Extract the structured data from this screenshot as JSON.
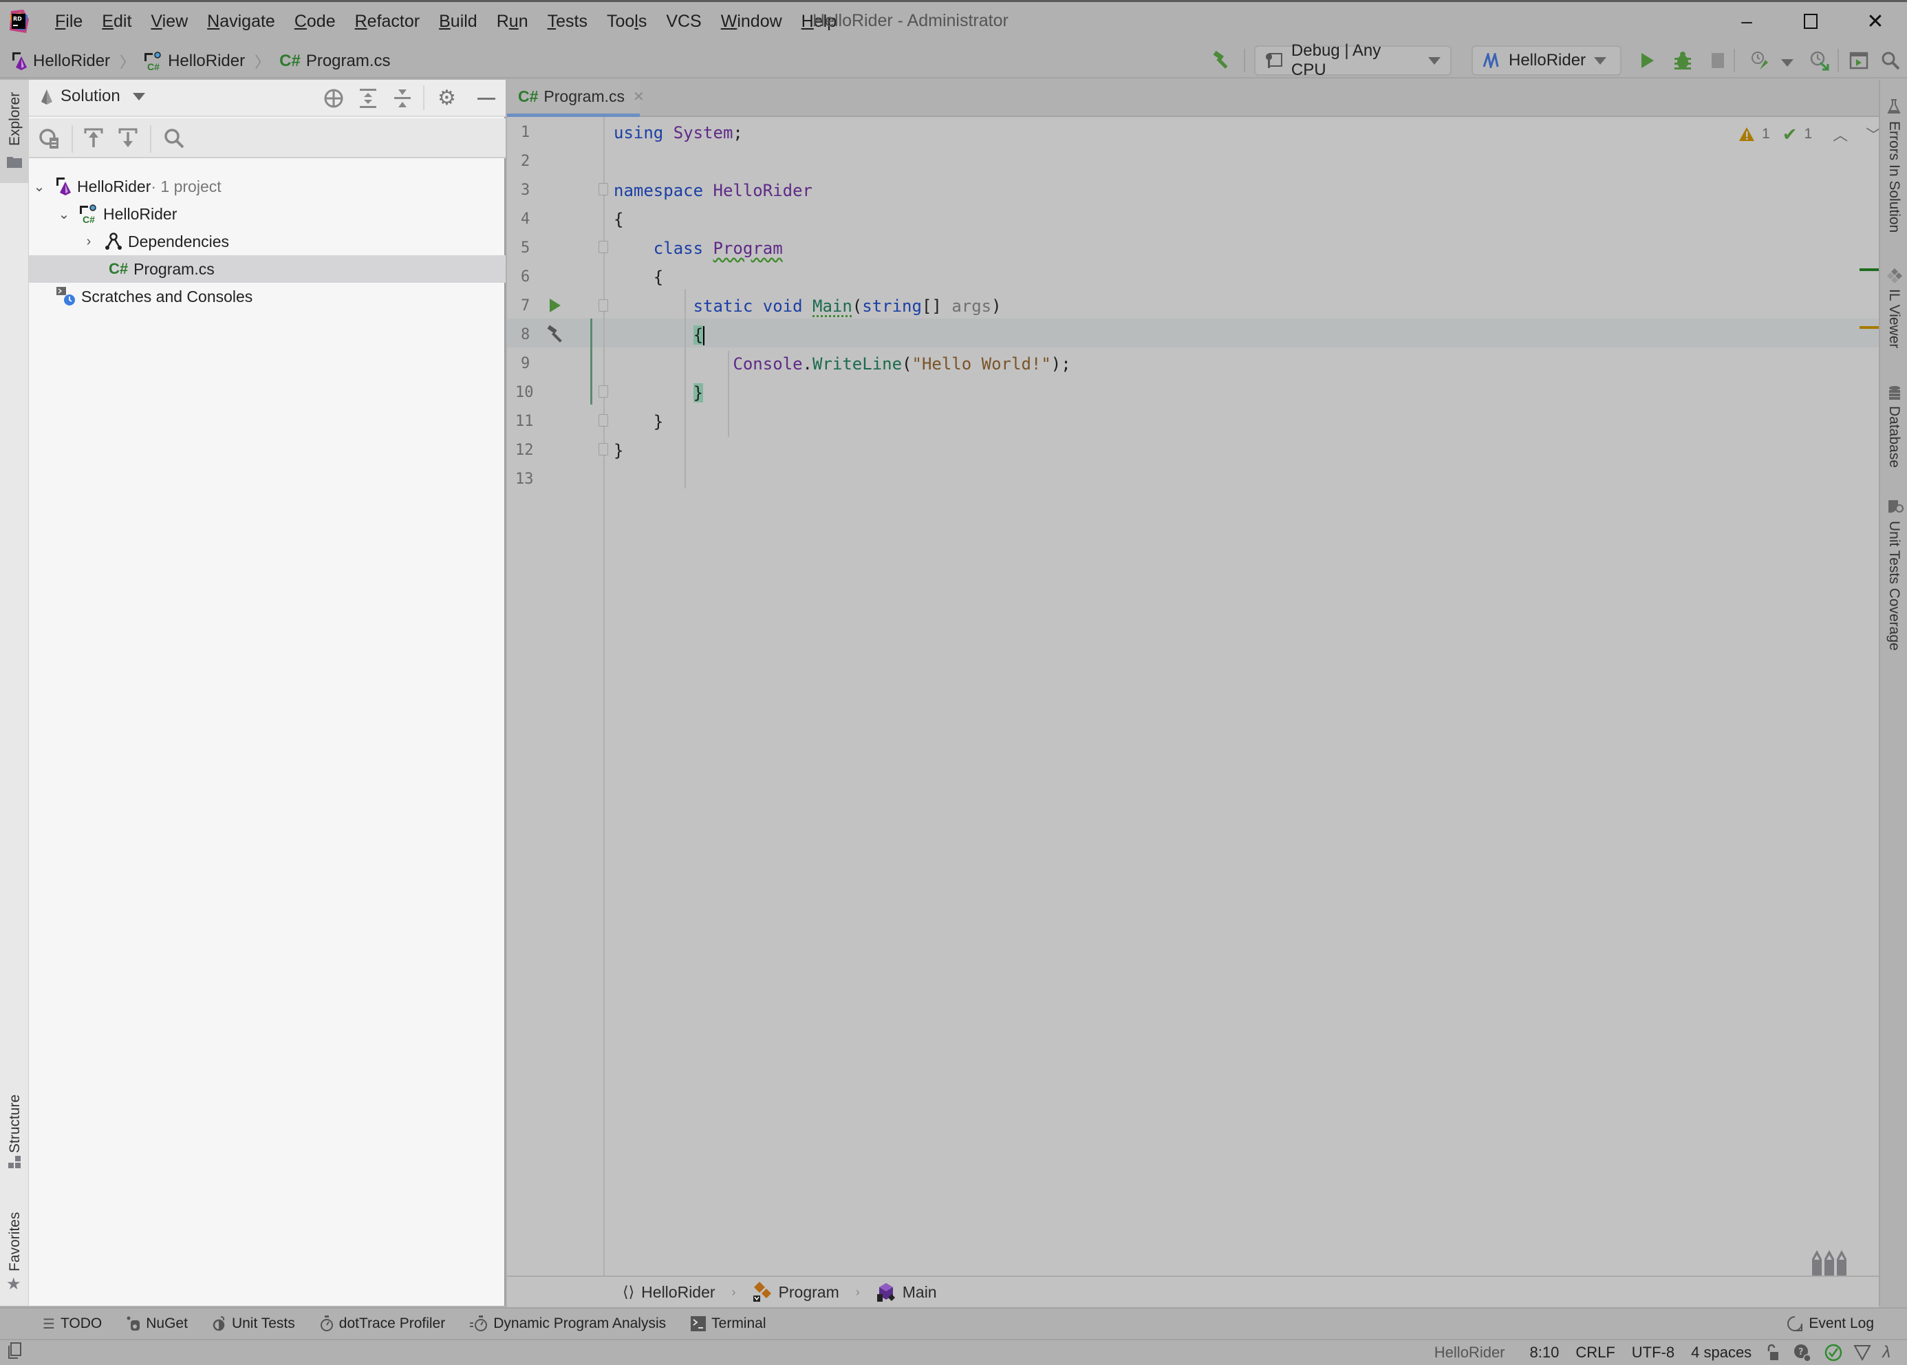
{
  "window": {
    "title": "HelloRider - Administrator",
    "controls": {
      "minimize": "–",
      "maximize": "☐",
      "close": "✕"
    }
  },
  "menu": [
    {
      "label": "File",
      "mnemonic": "F",
      "rest": "ile"
    },
    {
      "label": "Edit",
      "mnemonic": "E",
      "rest": "dit"
    },
    {
      "label": "View",
      "mnemonic": "V",
      "rest": "iew"
    },
    {
      "label": "Navigate",
      "mnemonic": "N",
      "rest": "avigate"
    },
    {
      "label": "Code",
      "mnemonic": "C",
      "rest": "ode"
    },
    {
      "label": "Refactor",
      "mnemonic": "R",
      "rest": "efactor"
    },
    {
      "label": "Build",
      "mnemonic": "B",
      "rest": "uild"
    },
    {
      "label": "Run",
      "pre": "R",
      "mnemonic": "u",
      "rest": "n"
    },
    {
      "label": "Tests",
      "mnemonic": "T",
      "rest": "ests"
    },
    {
      "label": "Tools",
      "pre": "Too",
      "mnemonic": "l",
      "rest": "s"
    },
    {
      "label": "VCS",
      "pre": "VCS",
      "mnemonic": "",
      "rest": ""
    },
    {
      "label": "Window",
      "mnemonic": "W",
      "rest": "indow"
    },
    {
      "label": "Help",
      "mnemonic": "H",
      "rest": "elp"
    }
  ],
  "navbar": {
    "breadcrumbs": [
      {
        "label": "HelloRider",
        "icon": "solution-icon"
      },
      {
        "label": "HelloRider",
        "icon": "csharp-project-icon"
      },
      {
        "label": "Program.cs",
        "icon": "csharp-file-icon"
      }
    ],
    "configuration": "Debug | Any CPU",
    "run_target": "HelloRider"
  },
  "left_stripe": {
    "top_tab": "Explorer",
    "bottom_tabs": [
      "Structure",
      "Favorites"
    ]
  },
  "explorer": {
    "view_selector": "Solution",
    "tree": [
      {
        "label": "HelloRider",
        "suffix": " · 1 project",
        "depth": 0,
        "expanded": true,
        "icon": "solution-icon"
      },
      {
        "label": "HelloRider",
        "depth": 1,
        "expanded": true,
        "icon": "csharp-project-icon"
      },
      {
        "label": "Dependencies",
        "depth": 2,
        "expanded": false,
        "icon": "dependencies-icon"
      },
      {
        "label": "Program.cs",
        "depth": 2,
        "selected": true,
        "icon": "csharp-file-icon"
      },
      {
        "label": "Scratches and Consoles",
        "depth": 0,
        "icon": "scratches-icon"
      }
    ]
  },
  "editor": {
    "tab": {
      "label": "Program.cs",
      "lang": "C#"
    },
    "inspection": {
      "warnings": "1",
      "ok": "1"
    },
    "lines": [
      "using System;",
      "",
      "namespace HelloRider",
      "{",
      "    class Program",
      "    {",
      "        static void Main(string[] args)",
      "        {",
      "            Console.WriteLine(\"Hello World!\");",
      "        }",
      "    }",
      "}",
      ""
    ],
    "line_numbers": [
      "1",
      "2",
      "3",
      "4",
      "5",
      "6",
      "7",
      "8",
      "9",
      "10",
      "11",
      "12",
      "13"
    ],
    "caret_line": 8,
    "code_breadcrumbs": [
      "HelloRider",
      "Program",
      "Main"
    ]
  },
  "right_stripe": [
    "Errors In Solution",
    "IL Viewer",
    "Database",
    "Unit Tests Coverage"
  ],
  "tool_windows": [
    "TODO",
    "NuGet",
    "Unit Tests",
    "dotTrace Profiler",
    "Dynamic Program Analysis",
    "Terminal"
  ],
  "event_log": "Event Log",
  "status": {
    "context": "HelloRider",
    "position": "8:10",
    "line_ending": "CRLF",
    "encoding": "UTF-8",
    "indent": "4 spaces"
  },
  "colors": {
    "accent_tab": "#6e8fc2",
    "run_green": "#4c8a3a",
    "warning": "#a87b00",
    "csharp": "#2f7a2f"
  }
}
